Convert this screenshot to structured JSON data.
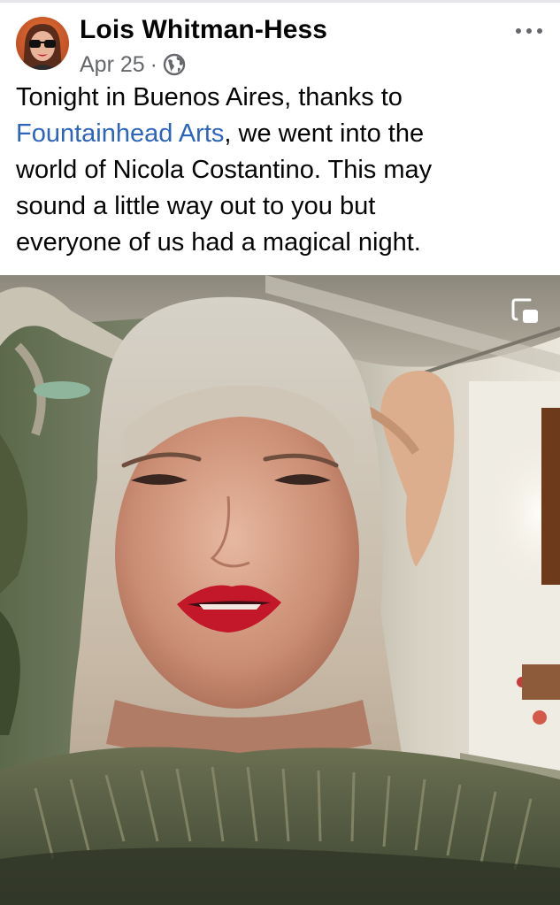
{
  "post": {
    "author": "Lois Whitman-Hess",
    "date": "Apr 25",
    "separator": "·",
    "audience_icon": "globe-icon",
    "more_icon": "ellipsis-icon",
    "text_lines": [
      {
        "before": "Tonight in Buenos Aires, thanks to",
        "link": "",
        "after": ""
      },
      {
        "before": "",
        "link": "Fountainhead Arts",
        "after": ", we went into the"
      },
      {
        "before": "world of Nicola Costantino. This may",
        "link": "",
        "after": ""
      },
      {
        "before": "sound a little way out to you but",
        "link": "",
        "after": ""
      },
      {
        "before": "everyone of us had a magical night.",
        "link": "",
        "after": ""
      }
    ]
  },
  "media": {
    "type": "video",
    "pip_icon": "picture-in-picture-icon"
  },
  "colors": {
    "text": "#050505",
    "secondary": "#65676b",
    "link": "#2d64bc"
  }
}
